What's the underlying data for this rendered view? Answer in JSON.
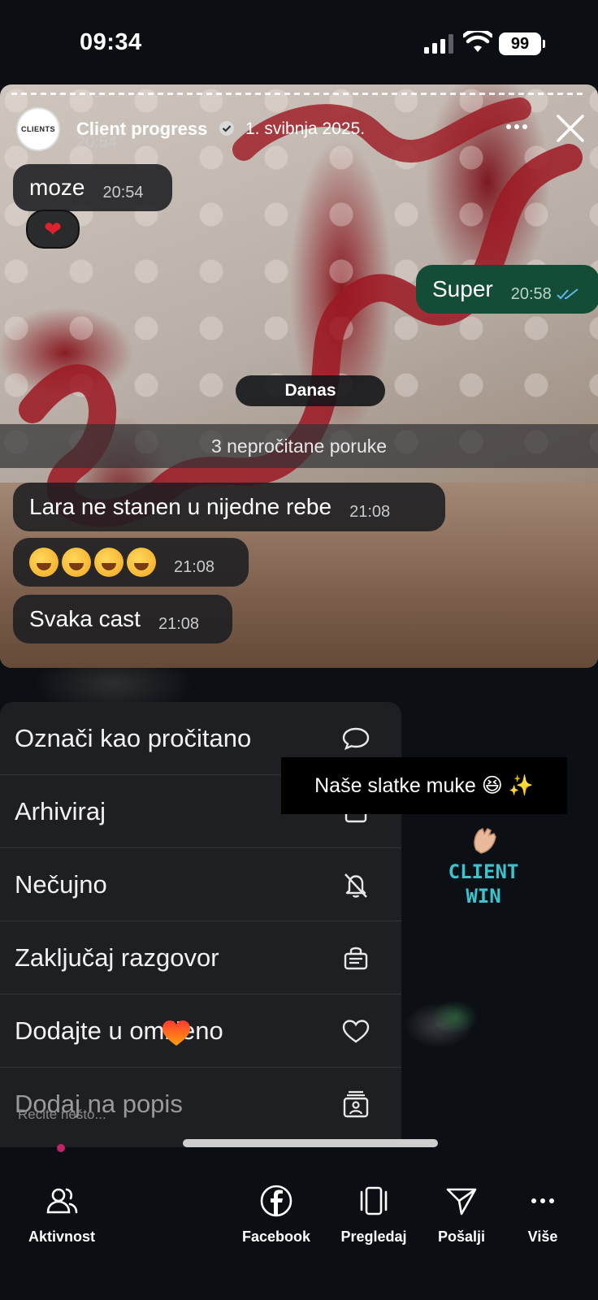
{
  "status_bar": {
    "time": "09:34",
    "battery": "99"
  },
  "story": {
    "account_name": "Client progress",
    "avatar_text": "CLIENTS",
    "posted_date": "1. svibnja 2025.",
    "ghost_time": "20:54"
  },
  "chat": {
    "messages": [
      {
        "text": "moze",
        "time": "20:54",
        "direction": "in"
      },
      {
        "text": "Super",
        "time": "20:58",
        "direction": "out"
      },
      {
        "text": "Lara ne stanen u nijedne rebe",
        "time": "21:08",
        "direction": "in"
      },
      {
        "text": "",
        "time": "21:08",
        "direction": "in"
      },
      {
        "text": "Svaka cast",
        "time": "21:08",
        "direction": "in"
      }
    ],
    "reaction": "❤",
    "day_separator": "Danas",
    "unread_banner": "3 nepročitane poruke"
  },
  "menu": {
    "items": [
      {
        "label": "Označi kao pročitano",
        "icon": "chat-bubble-icon"
      },
      {
        "label": "Arhiviraj",
        "icon": "archive-icon"
      },
      {
        "label": "Nečujno",
        "icon": "bell-slash-icon"
      },
      {
        "label": "Zaključaj razgovor",
        "icon": "lock-chat-icon"
      },
      {
        "label": "Dodajte u omiljeno",
        "icon": "heart-icon"
      },
      {
        "label": "Dodaj na popis",
        "icon": "list-person-icon"
      }
    ]
  },
  "overlay": {
    "caption": "Naše slatke muke 😆 ✨",
    "sticker_line1": "CLIENT",
    "sticker_line2": "WIN",
    "reply_hint": "Recite nešto..."
  },
  "bottom_bar": {
    "tabs": [
      {
        "label": "Aktivnost",
        "icon": "activity-icon"
      },
      {
        "label": "Facebook",
        "icon": "facebook-icon"
      },
      {
        "label": "Pregledaj",
        "icon": "preview-icon"
      },
      {
        "label": "Pošalji",
        "icon": "send-icon"
      },
      {
        "label": "Više",
        "icon": "more-icon"
      }
    ]
  },
  "colors": {
    "accent_green": "#144d37",
    "heart_red": "#e0212e",
    "sticker_cyan": "#39c5cf"
  }
}
